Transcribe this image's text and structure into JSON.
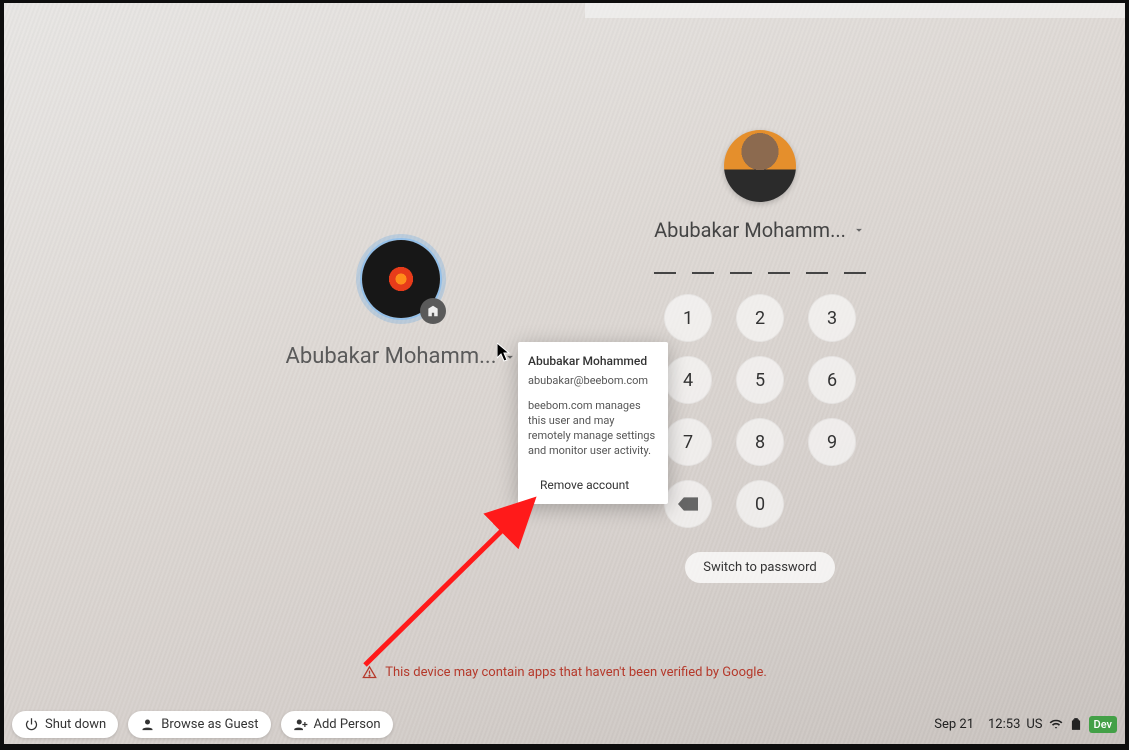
{
  "secondary_user": {
    "display_name": "Abubakar Mohamm...",
    "badge_icon": "enterprise-badge-icon"
  },
  "popup": {
    "full_name": "Abubakar Mohammed",
    "email": "abubakar@beebom.com",
    "management_note": "beebom.com manages this user and may remotely manage settings and monitor user activity.",
    "remove_label": "Remove account"
  },
  "primary_user": {
    "display_name": "Abubakar Mohamm...",
    "pin_length": 6,
    "keypad": {
      "keys": [
        "1",
        "2",
        "3",
        "4",
        "5",
        "6",
        "7",
        "8",
        "9",
        "",
        "0"
      ],
      "backspace_icon": "backspace-icon"
    },
    "switch_label": "Switch to password"
  },
  "warning_text": "This device may contain apps that haven't been verified by Google.",
  "shelf": {
    "shutdown_label": "Shut down",
    "guest_label": "Browse as Guest",
    "add_person_label": "Add Person"
  },
  "status": {
    "date": "Sep 21",
    "time": "12:53",
    "locale": "US",
    "dev_label": "Dev"
  }
}
